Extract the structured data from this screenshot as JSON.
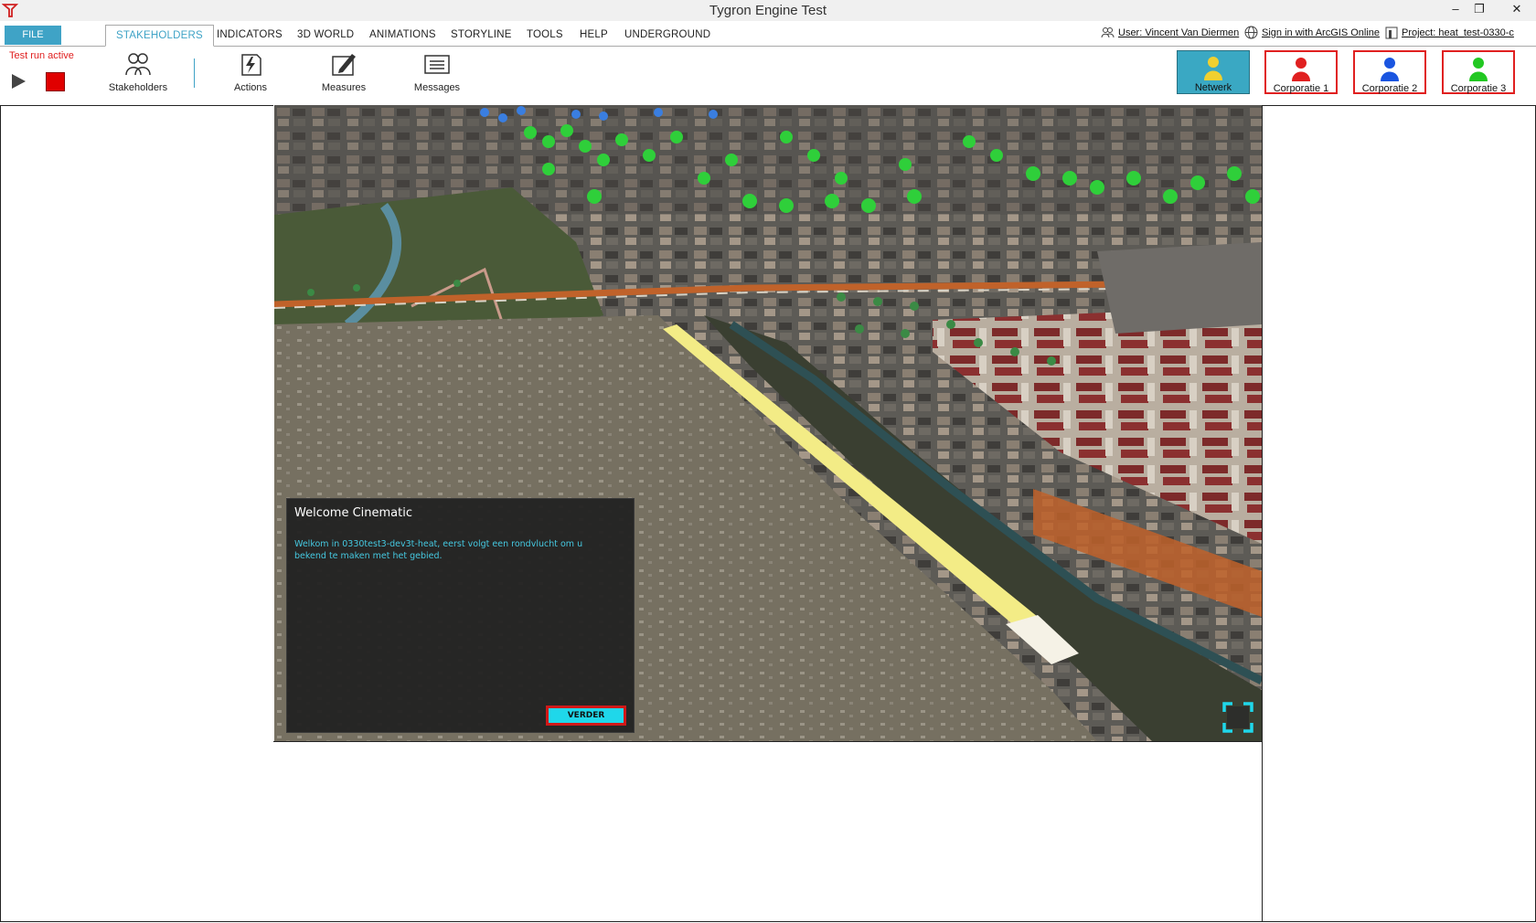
{
  "window": {
    "title": "Tygron Engine Test"
  },
  "menu": {
    "file": "FILE",
    "tabs": [
      "STAKEHOLDERS",
      "INDICATORS",
      "3D WORLD",
      "ANIMATIONS",
      "STORYLINE",
      "TOOLS",
      "HELP",
      "UNDERGROUND"
    ],
    "active_tab": "STAKEHOLDERS",
    "user": "User: Vincent Van Diermen",
    "arcgis": "Sign in with ArcGIS Online",
    "project": "Project: heat_test-0330-c"
  },
  "toolbar": {
    "test_run": "Test run active",
    "tools": [
      {
        "label": "Stakeholders",
        "icon": "people-icon"
      },
      {
        "label": "Actions",
        "icon": "lightning-icon"
      },
      {
        "label": "Measures",
        "icon": "pencil-icon"
      },
      {
        "label": "Messages",
        "icon": "message-icon"
      }
    ]
  },
  "stakeholders": [
    {
      "name": "Netwerk",
      "color": "#f0d030",
      "selected": true
    },
    {
      "name": "Corporatie 1",
      "color": "#e02020",
      "selected": false
    },
    {
      "name": "Corporatie 2",
      "color": "#1a55e0",
      "selected": false
    },
    {
      "name": "Corporatie 3",
      "color": "#22c822",
      "selected": false
    }
  ],
  "dialog": {
    "title": "Welcome Cinematic",
    "body": "Welkom in 0330test3-dev3t-heat, eerst volgt een rondvlucht om u bekend te maken met het gebied.",
    "button": "VERDER"
  },
  "colors": {
    "accent": "#3fa3c6",
    "alert": "#e02020",
    "dialog_text": "#45c8e0"
  }
}
